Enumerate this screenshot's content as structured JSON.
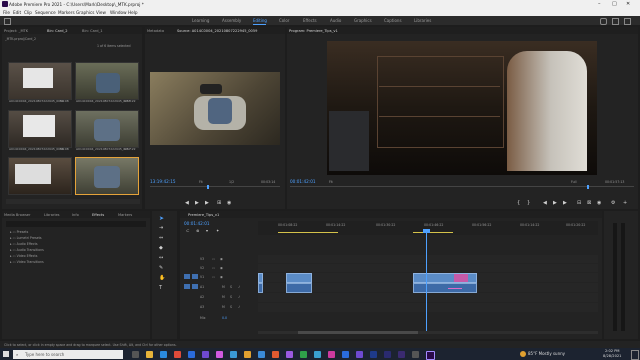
{
  "title_bar": {
    "title": "Adobe Premiere Pro 2021 - C:\\Users\\Mark\\Desktop\\_MTK.prproj *",
    "min": "–",
    "max": "□",
    "close": "✕"
  },
  "menu": [
    "File",
    "Edit",
    "Clip",
    "Sequence",
    "Markers",
    "Graphics",
    "View",
    "Window",
    "Help"
  ],
  "workspaces": [
    "Learning",
    "Assembly",
    "Editing",
    "Color",
    "Effects",
    "Audio",
    "Graphics",
    "Captions",
    "Libraries"
  ],
  "active_workspace": "Editing",
  "project_panel": {
    "tabs": [
      "Project: _MTK",
      "Bin: Card_2",
      "Bin: Card_1"
    ],
    "path": "_MTK.prproj\\Card_2",
    "items_selected": "1 of 6 items selected",
    "clips": [
      {
        "name": "A014C0004_20210807222945_0054",
        "dur": "00:08"
      },
      {
        "name": "A014C0004_20210807222945_0055",
        "dur": "1:17:22"
      },
      {
        "name": "A014C0004_20210807222945_0056",
        "dur": "00:08"
      },
      {
        "name": "A014C0004_20210807222945_0057",
        "dur": "1:17:22"
      },
      {
        "name": "A014C0004_20210807222945_0058",
        "dur": "00:08"
      },
      {
        "name": "A014C0004_20210807222945_0059",
        "dur": "1:17:22"
      }
    ]
  },
  "source_monitor": {
    "tabs": [
      "Metadata",
      "Source: A014C0004_20210807222945_0059"
    ],
    "timecode": "13:19:42:15",
    "fit": "Fit",
    "fraction": "1/2",
    "duration": "00:03:14"
  },
  "program_monitor": {
    "tab": "Program: Premiere_Tips_v1",
    "timecode": "00:01:42:01",
    "fit": "Fit",
    "quality": "Full",
    "duration": "00:01:57:13"
  },
  "effects_panel": {
    "tabs": [
      "Media Browser",
      "Libraries",
      "Info",
      "Effects",
      "Markers"
    ],
    "folders": [
      "Presets",
      "Lumetri Presets",
      "Audio Effects",
      "Audio Transitions",
      "Video Effects",
      "Video Transitions"
    ]
  },
  "timeline": {
    "tab": "Premiere_Tips_v1",
    "timecode": "00:01:42:01",
    "ruler": [
      "00:01:08:22",
      "00:01:14:22",
      "00:01:30:22",
      "00:01:46:22",
      "00:01:56:22",
      "00:01:14:22",
      "00:01:20:22"
    ],
    "video_tracks": [
      "V3",
      "V2",
      "V1"
    ],
    "audio_tracks": [
      "A1",
      "A2",
      "A3"
    ],
    "mix_label": "Mix",
    "mix_value": "0.0"
  },
  "status_text": "Click to select, or click in empty space and drag to marquee select. Use Shift, Alt, and Ctrl for other options.",
  "taskbar": {
    "search_placeholder": "Type here to search",
    "weather": "85°F  Mostly sunny",
    "time": "2:02 PM",
    "date": "8/28/2021"
  }
}
